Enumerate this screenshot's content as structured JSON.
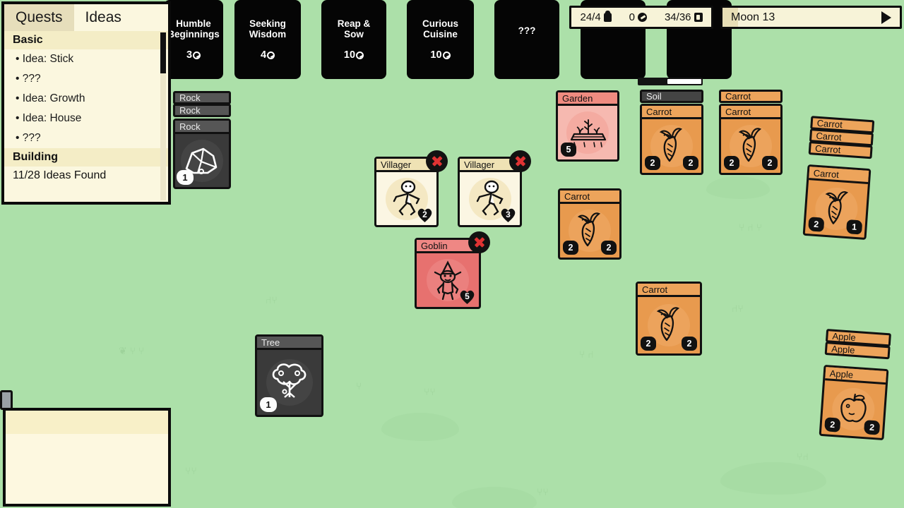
{
  "background": {
    "grass_color": "#ace0a9"
  },
  "hud": {
    "pack": "24/4",
    "coins": "0",
    "deck": "34/36",
    "pack_icon": "backpack-icon",
    "coin_icon": "coin-icon",
    "deck_icon": "deck-icon"
  },
  "moon": {
    "label": "Moon 13",
    "play_icon": "play-triangle-icon"
  },
  "quests": [
    {
      "title": "Humble\nBeginnings",
      "cost": "3"
    },
    {
      "title": "Seeking\nWisdom",
      "cost": "4"
    },
    {
      "title": "Reap &\nSow",
      "cost": "10"
    },
    {
      "title": "Curious\nCuisine",
      "cost": "10"
    },
    {
      "title": "???",
      "cost": ""
    },
    {
      "title": "",
      "cost": ""
    },
    {
      "title": "",
      "cost": ""
    }
  ],
  "panel": {
    "tabs": [
      {
        "label": "Quests",
        "active": true
      },
      {
        "label": "Ideas",
        "active": false
      }
    ],
    "sections": [
      {
        "heading": "Basic",
        "items": [
          "• Idea: Stick",
          "• ???",
          "• Idea: Growth",
          "• Idea: House",
          "• ???"
        ]
      },
      {
        "heading": "Building",
        "items": []
      }
    ],
    "footer": "11/28 Ideas Found"
  },
  "board_cards": [
    {
      "name": "rock-stack",
      "title": "Rock",
      "stack_labels": [
        "Rock",
        "Rock",
        "Rock"
      ],
      "art": "rock-icon",
      "badge_white": "1",
      "body_color": "#3a3a3a",
      "header_color": "#565656",
      "header_text_color": "#e9e9e9"
    },
    {
      "name": "villager-1",
      "title": "Villager",
      "art": "villager-icon",
      "heart": "2",
      "x_badge": true,
      "body_color": "#fbf6e3",
      "header_color": "#efe2b4",
      "header_text_color": "#111111"
    },
    {
      "name": "villager-2",
      "title": "Villager",
      "art": "villager-icon",
      "heart": "3",
      "x_badge": true,
      "body_color": "#fbf6e3",
      "header_color": "#efe2b4",
      "header_text_color": "#111111"
    },
    {
      "name": "goblin",
      "title": "Goblin",
      "art": "goblin-icon",
      "heart": "5",
      "x_badge": true,
      "body_color": "#e7716f",
      "header_color": "#ef8784",
      "header_text_color": "#111111"
    },
    {
      "name": "tree",
      "title": "Tree",
      "art": "tree-icon",
      "badge_white": "1",
      "body_color": "#3a3a3a",
      "header_color": "#565656",
      "header_text_color": "#e9e9e9"
    },
    {
      "name": "garden",
      "title": "Garden",
      "art": "garden-icon",
      "badge_blob": "5",
      "body_color": "#f6b9b0",
      "header_color": "#ef8b80",
      "header_text_color": "#111111"
    },
    {
      "name": "soil-carrot",
      "title": "Soil",
      "stack_labels": [
        "Soil",
        "Carrot"
      ],
      "art": "carrot-icon",
      "badge_left": "2",
      "badge_right": "2",
      "body_color": "#e89a4e",
      "header_color": "#444444",
      "header_text_color": "#eeeeee",
      "progress": true
    },
    {
      "name": "carrot-stack-2",
      "title": "Carrot",
      "stack_labels": [
        "Carrot",
        "Carrot"
      ],
      "art": "carrot-icon",
      "badge_left": "2",
      "badge_right": "2",
      "body_color": "#e89a4e",
      "header_color": "#eda45b",
      "header_text_color": "#111111"
    },
    {
      "name": "carrot-stack-4",
      "title": "Carrot",
      "stack_labels": [
        "Carrot",
        "Carrot",
        "Carrot",
        "Carrot"
      ],
      "art": "carrot-icon",
      "badge_left": "2",
      "badge_right": "1",
      "body_color": "#e89a4e",
      "header_color": "#eda45b",
      "header_text_color": "#111111"
    },
    {
      "name": "carrot-single-a",
      "title": "Carrot",
      "art": "carrot-icon",
      "badge_left": "2",
      "badge_right": "2",
      "body_color": "#e89a4e",
      "header_color": "#eda45b",
      "header_text_color": "#111111"
    },
    {
      "name": "carrot-single-b",
      "title": "Carrot",
      "art": "carrot-icon",
      "badge_left": "2",
      "badge_right": "2",
      "body_color": "#e89a4e",
      "header_color": "#eda45b",
      "header_text_color": "#111111"
    },
    {
      "name": "apple-stack",
      "title": "Apple",
      "stack_labels": [
        "Apple",
        "Apple",
        "Apple"
      ],
      "art": "apple-icon",
      "badge_left": "2",
      "badge_right": "2",
      "body_color": "#e89a4e",
      "header_color": "#eda45b",
      "header_text_color": "#111111"
    }
  ]
}
